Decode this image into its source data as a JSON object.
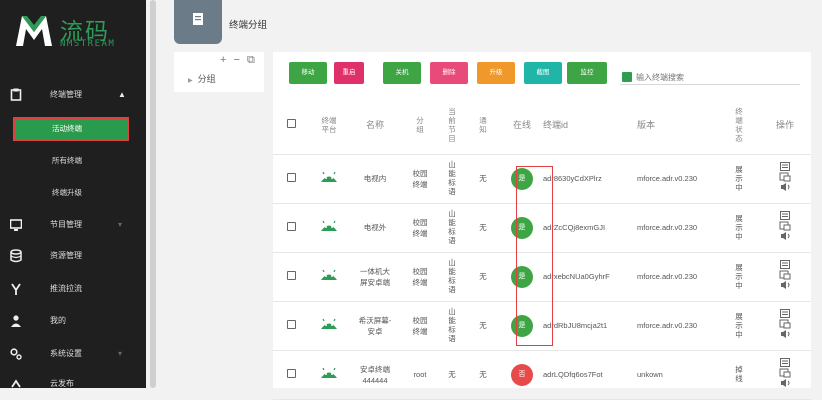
{
  "logo": {
    "cn": "流码",
    "en": "NMSTREAM"
  },
  "sidebar": {
    "items": [
      {
        "label": "终端管理",
        "icon": "square-icon"
      },
      {
        "label": "节目管理",
        "icon": "monitor-icon"
      },
      {
        "label": "资源管理",
        "icon": "database-icon"
      },
      {
        "label": "推流拉流",
        "icon": "fork-icon"
      },
      {
        "label": "我的",
        "icon": "user-icon"
      },
      {
        "label": "系统设置",
        "icon": "gear-icon"
      },
      {
        "label": "云发布",
        "icon": "cloud-icon"
      }
    ],
    "sub_items": [
      "活动终端",
      "所有终端",
      "终端升级"
    ]
  },
  "header": {
    "title": "终端分组"
  },
  "groups": {
    "tools": "+ − ⧉",
    "node": "分组"
  },
  "toolbar": {
    "buttons": [
      {
        "label": "移动",
        "color": "#3da544"
      },
      {
        "label": "重启",
        "color": "#e0306a"
      },
      {
        "label": "关机",
        "color": "#3da544"
      },
      {
        "label": "删除",
        "color": "#e84a7a"
      },
      {
        "label": "升级",
        "color": "#f0982a"
      },
      {
        "label": "截图",
        "color": "#1fb6a8"
      },
      {
        "label": "监控",
        "color": "#3da544"
      }
    ]
  },
  "search": {
    "placeholder": "输入终端搜索"
  },
  "table": {
    "headers": [
      "终端平台",
      "名称",
      "分组",
      "当前节目",
      "通知",
      "在线",
      "终端id",
      "版本",
      "终端状态",
      "操作"
    ],
    "rows": [
      {
        "name": "电视内",
        "group": "校园终端",
        "program": "山能标语",
        "notice": "无",
        "online": "是",
        "online_color": "#3da544",
        "id": "adr8630yCdXPlrz",
        "version": "mforce.adr.v0.230",
        "state": "展示中"
      },
      {
        "name": "电视外",
        "group": "校园终端",
        "program": "山能标语",
        "notice": "无",
        "online": "是",
        "online_color": "#3da544",
        "id": "adrZcCQj8exmGJI",
        "version": "mforce.adr.v0.230",
        "state": "展示中"
      },
      {
        "name": "一体机大屏安卓端",
        "group": "校园终端",
        "program": "山能标语",
        "notice": "无",
        "online": "是",
        "online_color": "#3da544",
        "id": "adrxebcNUa0GyhrF",
        "version": "mforce.adr.v0.230",
        "state": "展示中"
      },
      {
        "name": "希沃屏幕-安卓",
        "group": "校园终端",
        "program": "山能标语",
        "notice": "无",
        "online": "是",
        "online_color": "#3da544",
        "id": "adrdRbJU8mcja2t1",
        "version": "mforce.adr.v0.230",
        "state": "展示中"
      },
      {
        "name": "安卓终端444444",
        "group": "root",
        "program": "无",
        "notice": "无",
        "online": "否",
        "online_color": "#e84a4a",
        "id": "adrLQDfq6os7Fot",
        "version": "unkown",
        "state": "掉线"
      }
    ]
  }
}
